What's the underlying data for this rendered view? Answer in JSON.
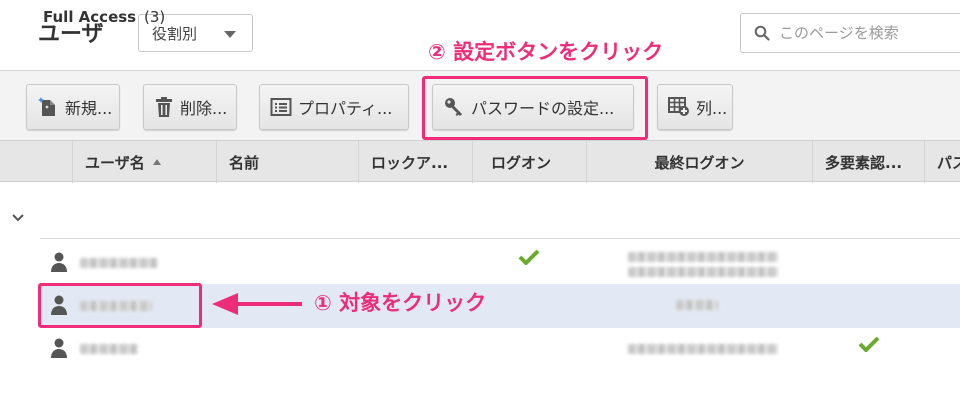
{
  "header": {
    "title": "ユーザ",
    "role_filter": "役割別",
    "search_placeholder": "このページを検索"
  },
  "toolbar": {
    "new_label": "新規...",
    "delete_label": "削除...",
    "properties_label": "プロパティ...",
    "password_label": "パスワードの設定...",
    "columns_label": "列..."
  },
  "columns": {
    "username": "ユーザ名",
    "name": "名前",
    "lockout": "ロックア...",
    "logon": "ログオン",
    "last_logon": "最終ログオン",
    "mfa": "多要素認...",
    "more": "パス"
  },
  "group": {
    "label": "Full Access",
    "count": "(3)"
  },
  "annotations": {
    "step1": "① 対象をクリック",
    "step2": "② 設定ボタンをクリック",
    "color": "#ee2d7a"
  },
  "colors": {
    "check": "#6aab2e",
    "selected_row": "#e3e9f4"
  }
}
